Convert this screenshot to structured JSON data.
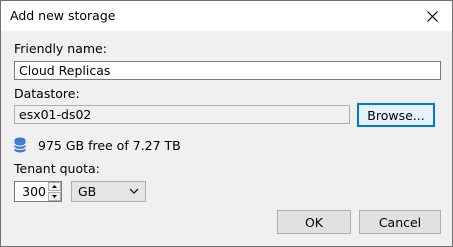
{
  "window": {
    "title": "Add new storage"
  },
  "form": {
    "friendly_name_label": "Friendly name:",
    "friendly_name_value": "Cloud Replicas",
    "datastore_label": "Datastore:",
    "datastore_value": "esx01-ds02",
    "browse_label": "Browse...",
    "free_space_text": "975 GB free of 7.27 TB",
    "tenant_quota_label": "Tenant quota:",
    "quota_value": "300",
    "quota_unit": "GB"
  },
  "footer": {
    "ok_label": "OK",
    "cancel_label": "Cancel"
  },
  "icons": {
    "close": "close-icon",
    "storage": "database-icon",
    "spin_up": "spin-up-icon",
    "spin_down": "spin-down-icon",
    "dropdown": "chevron-down-icon"
  },
  "colors": {
    "focus_border": "#0078d7",
    "storage_icon": "#3a7cc7"
  }
}
